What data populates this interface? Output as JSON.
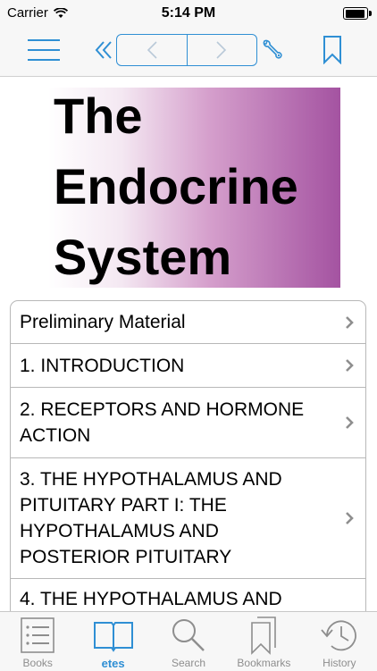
{
  "status_bar": {
    "carrier": "Carrier",
    "time": "5:14 PM"
  },
  "nav_icons": [
    "menu-icon",
    "double-chevron-left-icon",
    "back-arrow-icon",
    "forward-arrow-icon",
    "wrench-icon",
    "bookmark-icon"
  ],
  "cover": {
    "lines": [
      "The",
      "Endocrine",
      "System"
    ],
    "gradient_colors": [
      "#ffffff",
      "#a453a1"
    ]
  },
  "toc": {
    "items": [
      {
        "label": "Preliminary Material"
      },
      {
        "label": "1. INTRODUCTION"
      },
      {
        "label": "2. RECEPTORS AND HORMONE ACTION"
      },
      {
        "label": "3. THE HYPOTHALAMUS AND PITUITARY PART I: THE HYPOTHALAMUS AND POSTERIOR PITUITARY"
      },
      {
        "label": "4. THE HYPOTHALAMUS AND"
      }
    ]
  },
  "tabs": [
    {
      "label": "Books",
      "icon": "books-icon"
    },
    {
      "label": "etes",
      "icon": "open-book-icon",
      "active": true
    },
    {
      "label": "Search",
      "icon": "search-icon"
    },
    {
      "label": "Bookmarks",
      "icon": "bookmarks-icon"
    },
    {
      "label": "History",
      "icon": "history-icon"
    }
  ],
  "colors": {
    "accent": "#2f8fd4",
    "inactive": "#8e8e8e",
    "chevron": "#8e8e8e"
  }
}
